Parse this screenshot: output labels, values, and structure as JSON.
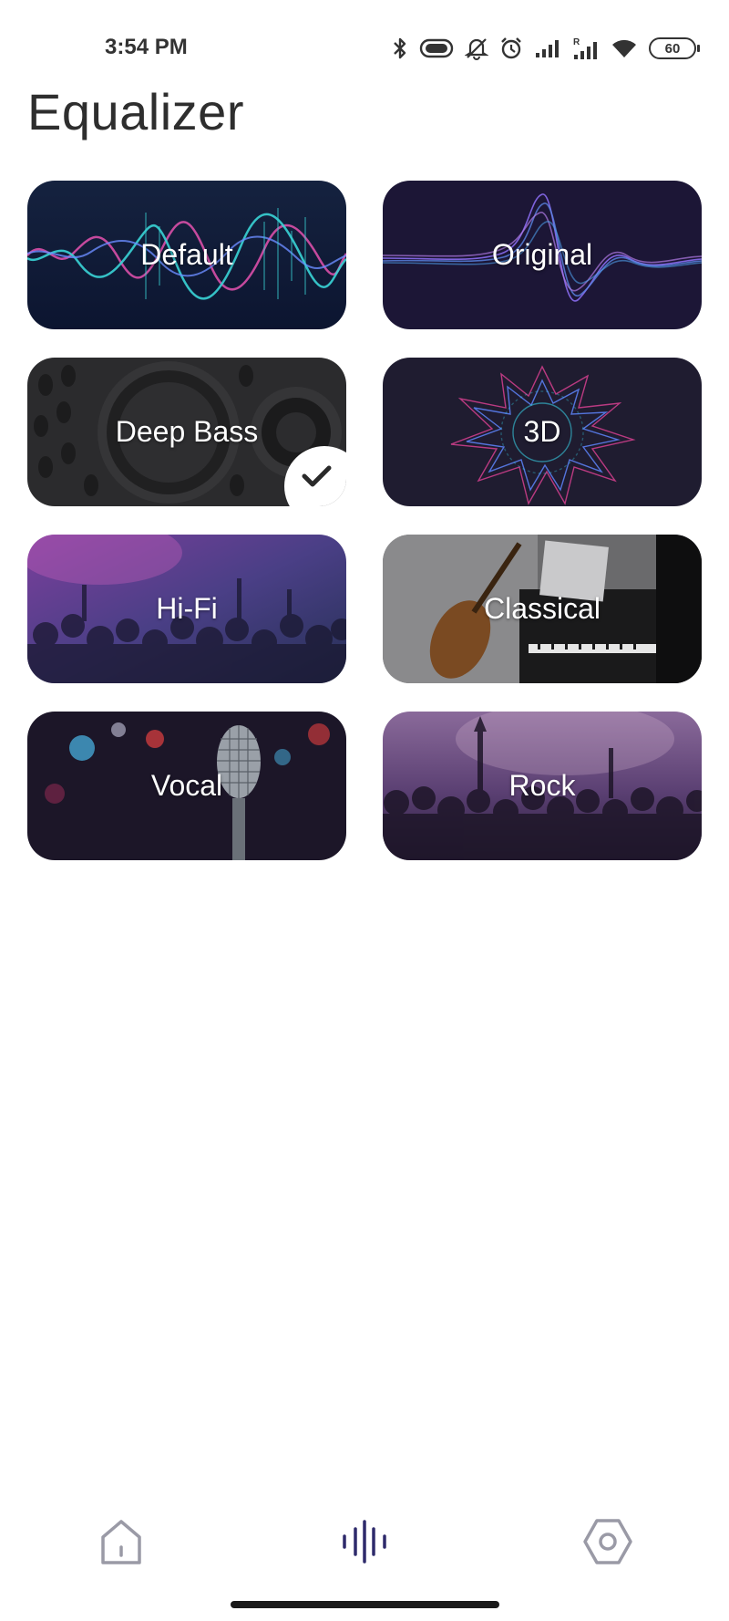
{
  "status_bar": {
    "time": "3:54 PM",
    "battery": "60",
    "icons": [
      "bluetooth-icon",
      "vibrate-icon",
      "mute-icon",
      "alarm-icon",
      "signal-icon",
      "signal-roaming-icon",
      "wifi-icon",
      "battery-icon"
    ]
  },
  "page": {
    "title": "Equalizer"
  },
  "presets": [
    {
      "label": "Default",
      "selected": false
    },
    {
      "label": "Original",
      "selected": false
    },
    {
      "label": "Deep Bass",
      "selected": true
    },
    {
      "label": "3D",
      "selected": false
    },
    {
      "label": "Hi-Fi",
      "selected": false
    },
    {
      "label": "Classical",
      "selected": false
    },
    {
      "label": "Vocal",
      "selected": false
    },
    {
      "label": "Rock",
      "selected": false
    }
  ],
  "bottom_nav": {
    "items": [
      "home-icon",
      "equalizer-icon",
      "settings-icon"
    ],
    "active": "equalizer-icon",
    "active_color": "#2e2a6b",
    "inactive_color": "#9a9aa6"
  }
}
